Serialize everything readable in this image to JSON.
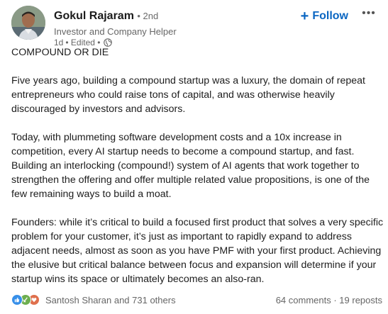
{
  "author": {
    "name": "Gokul Rajaram",
    "degree": "• 2nd",
    "headline": "Investor and Company Helper",
    "time": "1d",
    "edited": "• Edited •"
  },
  "actions": {
    "follow_label": "Follow",
    "more_label": "•••"
  },
  "post": {
    "paragraphs": [
      "COMPOUND OR DIE",
      "Five years ago, building a compound startup was a luxury, the domain of repeat entrepreneurs who could raise tons of capital, and was otherwise heavily discouraged by investors and advisors.",
      "Today, with plummeting software development costs and a 10x increase in competition, every AI startup needs to become a compound startup, and fast. Building an interlocking (compound!) system of AI agents that work together to strengthen the offering and offer multiple related value propositions, is one of the few remaining ways to build a moat.",
      "Founders: while it’s critical to build a focused first product that solves a very specific problem for your customer, it’s just as important to rapidly expand to address adjacent needs, almost as soon as you have PMF with your first product. Achieving the elusive but critical balance between focus and expansion will determine if your startup wins its space or ultimately becomes an also-ran."
    ]
  },
  "social": {
    "reaction_icons": [
      "like-icon",
      "celebrate-icon",
      "love-icon"
    ],
    "reactors_text": "Santosh Sharan and 731 others",
    "comments_text": "64 comments",
    "separator": " · ",
    "reposts_text": "19 reposts"
  },
  "colors": {
    "accent": "#0a66c2",
    "like": "#378fe9",
    "celebrate": "#6dae4f",
    "love": "#df704d"
  }
}
